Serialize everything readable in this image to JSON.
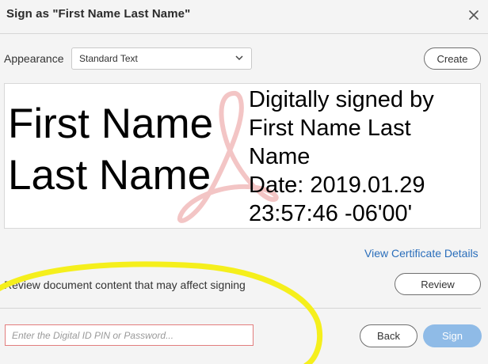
{
  "dialog": {
    "title": "Sign as \"First Name Last Name\"",
    "close_icon": "close-icon"
  },
  "appearance": {
    "label": "Appearance",
    "selected": "Standard Text",
    "create_label": "Create"
  },
  "preview": {
    "name_line1": "First Name",
    "name_line2": "Last Name",
    "detail_lines": [
      "Digitally signed by",
      "First Name Last",
      "Name",
      "Date: 2019.01.29",
      "23:57:46 -06'00'"
    ],
    "watermark_icon": "acrobat-logo-watermark"
  },
  "certificate": {
    "link_label": "View Certificate Details"
  },
  "review": {
    "text": "Review document content that may affect signing",
    "button_label": "Review"
  },
  "footer": {
    "pin_placeholder": "Enter the Digital ID PIN or Password...",
    "pin_value": "",
    "back_label": "Back",
    "sign_label": "Sign"
  },
  "colors": {
    "accent": "#2a6ebb",
    "sign_button": "#8fbbe7",
    "input_error_border": "#e27d7d",
    "highlight_annotation": "#f5ef1c"
  }
}
